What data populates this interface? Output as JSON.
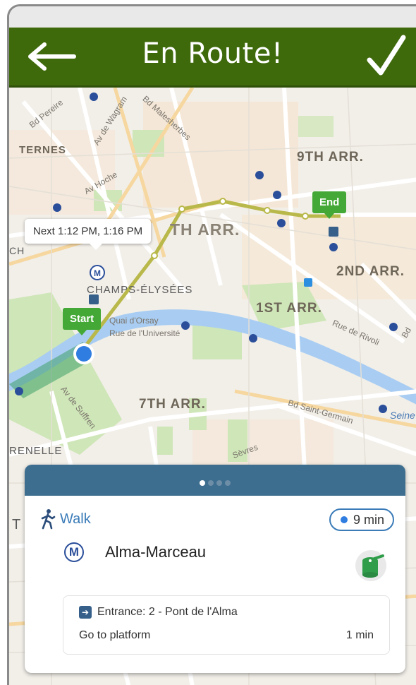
{
  "header": {
    "title": "En Route!",
    "back_icon": "arrow-left-icon",
    "confirm_icon": "check-icon",
    "bg_color": "#3f6a0c"
  },
  "map": {
    "districts": [
      "TERNES",
      "9TH ARR.",
      "TH ARR.",
      "2ND ARR.",
      "CHAMPS-ÉLYSÉES",
      "1ST ARR.",
      "7TH ARR.",
      "RENELLE",
      "T",
      "CH"
    ],
    "streets": [
      "Bd Pereire",
      "Av de Wagram",
      "Bd Malesherbes",
      "Av Hoche",
      "Quai d'Orsay",
      "Rue de l'Université",
      "Rue de Rivoli",
      "Bd Saint-Germain",
      "Av de Suffren",
      "Sèvres",
      "Seine",
      "Bd"
    ],
    "tooltip": "Next 1:12 PM, 1:16 PM",
    "start_label": "Start",
    "end_label": "End",
    "route_color": "#b9b84a"
  },
  "panel": {
    "page_count": 4,
    "active_page": 1,
    "mode": "Walk",
    "duration": "9 min",
    "station_icon_label": "M",
    "station": "Alma-Marceau",
    "entrance_icon_label": "➔",
    "entrance": "Entrance: 2 - Pont de l'Alma",
    "step": "Go to platform",
    "step_time": "1 min"
  }
}
